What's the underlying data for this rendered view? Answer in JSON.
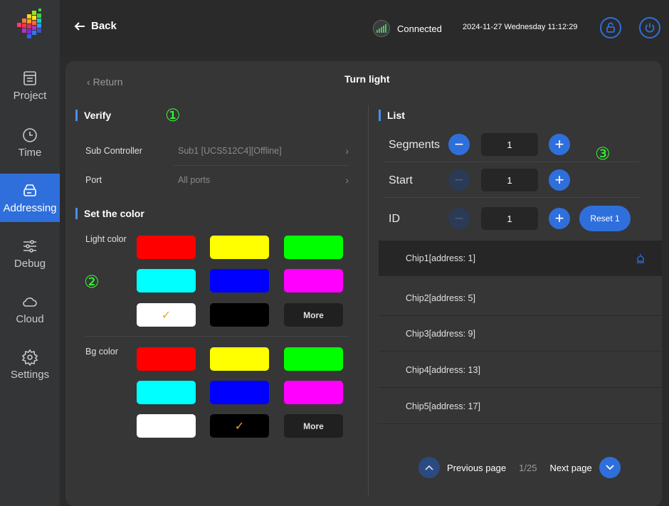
{
  "sidebar": {
    "items": [
      {
        "label": "Project",
        "icon": "project-icon"
      },
      {
        "label": "Time",
        "icon": "clock-icon"
      },
      {
        "label": "Addressing",
        "icon": "addressing-icon"
      },
      {
        "label": "Debug",
        "icon": "sliders-icon"
      },
      {
        "label": "Cloud",
        "icon": "cloud-icon"
      },
      {
        "label": "Settings",
        "icon": "gear-icon"
      }
    ],
    "active": "Addressing"
  },
  "topbar": {
    "back_label": "Back",
    "status": "Connected",
    "datetime": "2024-11-27 Wednesday 11:12:29"
  },
  "page": {
    "return_label": "Return",
    "title": "Turn light"
  },
  "verify": {
    "section": "Verify",
    "sub_controller_label": "Sub Controller",
    "sub_controller_value": "Sub1 [UCS512C4][Offline]",
    "port_label": "Port",
    "port_value": "All ports"
  },
  "color": {
    "section": "Set the color",
    "light_label": "Light color",
    "bg_label": "Bg color",
    "more_label": "More",
    "light_selected": "white",
    "bg_selected": "black",
    "swatches": [
      "#ff0000",
      "#ffff00",
      "#00ff00",
      "#00ffff",
      "#0000ff",
      "#ff00ff",
      "#ffffff",
      "#000000"
    ]
  },
  "annotations": {
    "one": "①",
    "two": "②",
    "three": "③"
  },
  "list": {
    "section": "List",
    "segments_label": "Segments",
    "segments_value": "1",
    "start_label": "Start",
    "start_value": "1",
    "id_label": "ID",
    "id_value": "1",
    "reset_label": "Reset 1",
    "chips": [
      "Chip1[address: 1]",
      "Chip2[address: 5]",
      "Chip3[address: 9]",
      "Chip4[address: 13]",
      "Chip5[address: 17]"
    ],
    "selected_chip": 0
  },
  "pager": {
    "prev_label": "Previous page",
    "page": "1/25",
    "next_label": "Next page"
  },
  "colors": {
    "accent": "#2f6fdc",
    "annotation": "#33ff33",
    "check": "#f0a030"
  }
}
